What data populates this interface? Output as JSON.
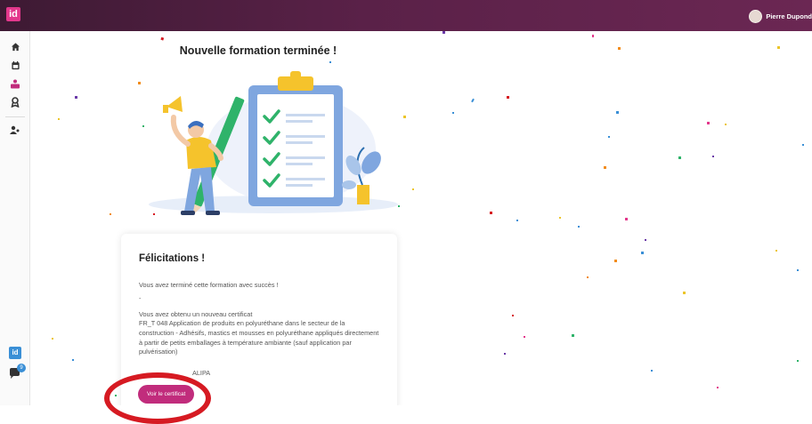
{
  "header": {
    "logo_text": "id",
    "user_name": "Pierre Dupond"
  },
  "sidebar": {
    "items": [
      {
        "icon": "home-icon"
      },
      {
        "icon": "calendar-icon"
      },
      {
        "icon": "training-icon",
        "active": true
      },
      {
        "icon": "award-icon"
      },
      {
        "icon": "users-icon"
      }
    ],
    "badge_text": "id",
    "chat_count": "9"
  },
  "main": {
    "title": "Nouvelle formation terminée !",
    "card": {
      "heading": "Félicitations !",
      "description": "Vous avez terminé cette formation avec succès !",
      "dash": "-",
      "cert_intro": "Vous avez obtenu un nouveau certificat",
      "cert_name": "FR_T 048 Application de produits en polyuréthane dans le secteur de la construction - Adhésifs, mastics et mousses en polyuréthane appliqués directement à partir de petits emballages à température ambiante (sauf application par pulvérisation)",
      "org": "ALIPA",
      "button_label": "Voir le certificat"
    }
  },
  "colors": {
    "header": "#5a2148",
    "accent": "#c12c7c",
    "highlight": "#d61a22",
    "check": "#2fb36a"
  }
}
